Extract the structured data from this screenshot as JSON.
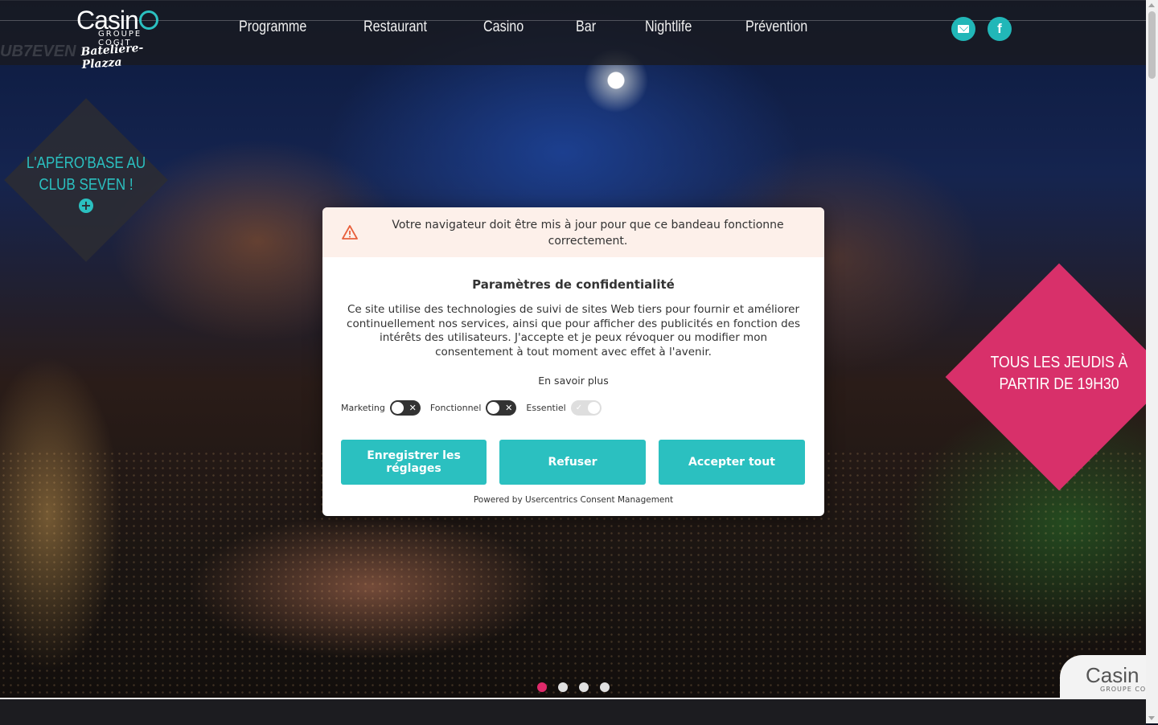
{
  "header": {
    "logo": {
      "brand": "Casin",
      "brand_o": "o",
      "sub": "GROUPE COGIT",
      "script": "Batelière-Plazza"
    },
    "nav": [
      "Programme",
      "Restaurant",
      "Casino",
      "Bar",
      "Nightlife",
      "Prévention"
    ],
    "social": {
      "mail_icon": "envelope-icon",
      "facebook_label": "f"
    },
    "ghost_text": "UB7EVEN"
  },
  "hero": {
    "left_promo": {
      "line1": "L'APÉRO'BASE AU",
      "line2": "CLUB SEVEN !",
      "plus": "+"
    },
    "right_promo": {
      "line1": "TOUS LES JEUDIS À",
      "line2": "PARTIR DE 19H30"
    },
    "corner_badge": {
      "brand": "Casin",
      "sub": "GROUPE CO"
    },
    "slides": {
      "count": 4,
      "active": 1
    }
  },
  "consent": {
    "warning": "Votre navigateur doit être mis à jour pour que ce bandeau fonctionne correctement.",
    "title": "Paramètres de confidentialité",
    "description": "Ce site utilise des technologies de suivi de sites Web tiers pour fournir et améliorer continuellement nos services, ainsi que pour afficher des publicités en fonction des intérêts des utilisateurs. J'accepte et je peux révoquer ou modifier mon consentement à tout moment avec effet à l'avenir.",
    "more_link": "En savoir plus",
    "toggles": [
      {
        "label": "Marketing",
        "on": false
      },
      {
        "label": "Fonctionnel",
        "on": false
      },
      {
        "label": "Essentiel",
        "on": true,
        "disabled": true
      }
    ],
    "buttons": {
      "save": "Enregistrer les réglages",
      "refuse": "Refuser",
      "accept": "Accepter tout"
    },
    "powered": "Powered by Usercentrics Consent Management"
  },
  "colors": {
    "accent": "#2bc0c0",
    "pink": "#d8306a",
    "dot_active": "#e02a6b",
    "warning_bg": "#fdf0ea"
  }
}
